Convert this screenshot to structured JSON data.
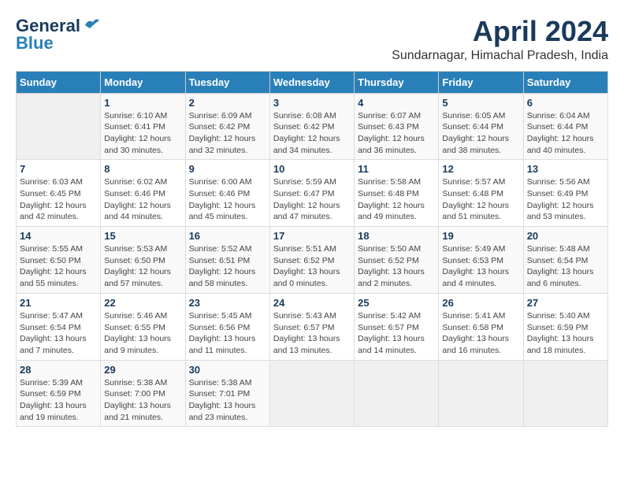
{
  "header": {
    "logo_general": "General",
    "logo_blue": "Blue",
    "month": "April 2024",
    "location": "Sundarnagar, Himachal Pradesh, India"
  },
  "calendar": {
    "days_of_week": [
      "Sunday",
      "Monday",
      "Tuesday",
      "Wednesday",
      "Thursday",
      "Friday",
      "Saturday"
    ],
    "weeks": [
      [
        {
          "day": "",
          "info": ""
        },
        {
          "day": "1",
          "info": "Sunrise: 6:10 AM\nSunset: 6:41 PM\nDaylight: 12 hours\nand 30 minutes."
        },
        {
          "day": "2",
          "info": "Sunrise: 6:09 AM\nSunset: 6:42 PM\nDaylight: 12 hours\nand 32 minutes."
        },
        {
          "day": "3",
          "info": "Sunrise: 6:08 AM\nSunset: 6:42 PM\nDaylight: 12 hours\nand 34 minutes."
        },
        {
          "day": "4",
          "info": "Sunrise: 6:07 AM\nSunset: 6:43 PM\nDaylight: 12 hours\nand 36 minutes."
        },
        {
          "day": "5",
          "info": "Sunrise: 6:05 AM\nSunset: 6:44 PM\nDaylight: 12 hours\nand 38 minutes."
        },
        {
          "day": "6",
          "info": "Sunrise: 6:04 AM\nSunset: 6:44 PM\nDaylight: 12 hours\nand 40 minutes."
        }
      ],
      [
        {
          "day": "7",
          "info": "Sunrise: 6:03 AM\nSunset: 6:45 PM\nDaylight: 12 hours\nand 42 minutes."
        },
        {
          "day": "8",
          "info": "Sunrise: 6:02 AM\nSunset: 6:46 PM\nDaylight: 12 hours\nand 44 minutes."
        },
        {
          "day": "9",
          "info": "Sunrise: 6:00 AM\nSunset: 6:46 PM\nDaylight: 12 hours\nand 45 minutes."
        },
        {
          "day": "10",
          "info": "Sunrise: 5:59 AM\nSunset: 6:47 PM\nDaylight: 12 hours\nand 47 minutes."
        },
        {
          "day": "11",
          "info": "Sunrise: 5:58 AM\nSunset: 6:48 PM\nDaylight: 12 hours\nand 49 minutes."
        },
        {
          "day": "12",
          "info": "Sunrise: 5:57 AM\nSunset: 6:48 PM\nDaylight: 12 hours\nand 51 minutes."
        },
        {
          "day": "13",
          "info": "Sunrise: 5:56 AM\nSunset: 6:49 PM\nDaylight: 12 hours\nand 53 minutes."
        }
      ],
      [
        {
          "day": "14",
          "info": "Sunrise: 5:55 AM\nSunset: 6:50 PM\nDaylight: 12 hours\nand 55 minutes."
        },
        {
          "day": "15",
          "info": "Sunrise: 5:53 AM\nSunset: 6:50 PM\nDaylight: 12 hours\nand 57 minutes."
        },
        {
          "day": "16",
          "info": "Sunrise: 5:52 AM\nSunset: 6:51 PM\nDaylight: 12 hours\nand 58 minutes."
        },
        {
          "day": "17",
          "info": "Sunrise: 5:51 AM\nSunset: 6:52 PM\nDaylight: 13 hours\nand 0 minutes."
        },
        {
          "day": "18",
          "info": "Sunrise: 5:50 AM\nSunset: 6:52 PM\nDaylight: 13 hours\nand 2 minutes."
        },
        {
          "day": "19",
          "info": "Sunrise: 5:49 AM\nSunset: 6:53 PM\nDaylight: 13 hours\nand 4 minutes."
        },
        {
          "day": "20",
          "info": "Sunrise: 5:48 AM\nSunset: 6:54 PM\nDaylight: 13 hours\nand 6 minutes."
        }
      ],
      [
        {
          "day": "21",
          "info": "Sunrise: 5:47 AM\nSunset: 6:54 PM\nDaylight: 13 hours\nand 7 minutes."
        },
        {
          "day": "22",
          "info": "Sunrise: 5:46 AM\nSunset: 6:55 PM\nDaylight: 13 hours\nand 9 minutes."
        },
        {
          "day": "23",
          "info": "Sunrise: 5:45 AM\nSunset: 6:56 PM\nDaylight: 13 hours\nand 11 minutes."
        },
        {
          "day": "24",
          "info": "Sunrise: 5:43 AM\nSunset: 6:57 PM\nDaylight: 13 hours\nand 13 minutes."
        },
        {
          "day": "25",
          "info": "Sunrise: 5:42 AM\nSunset: 6:57 PM\nDaylight: 13 hours\nand 14 minutes."
        },
        {
          "day": "26",
          "info": "Sunrise: 5:41 AM\nSunset: 6:58 PM\nDaylight: 13 hours\nand 16 minutes."
        },
        {
          "day": "27",
          "info": "Sunrise: 5:40 AM\nSunset: 6:59 PM\nDaylight: 13 hours\nand 18 minutes."
        }
      ],
      [
        {
          "day": "28",
          "info": "Sunrise: 5:39 AM\nSunset: 6:59 PM\nDaylight: 13 hours\nand 19 minutes."
        },
        {
          "day": "29",
          "info": "Sunrise: 5:38 AM\nSunset: 7:00 PM\nDaylight: 13 hours\nand 21 minutes."
        },
        {
          "day": "30",
          "info": "Sunrise: 5:38 AM\nSunset: 7:01 PM\nDaylight: 13 hours\nand 23 minutes."
        },
        {
          "day": "",
          "info": ""
        },
        {
          "day": "",
          "info": ""
        },
        {
          "day": "",
          "info": ""
        },
        {
          "day": "",
          "info": ""
        }
      ]
    ]
  }
}
